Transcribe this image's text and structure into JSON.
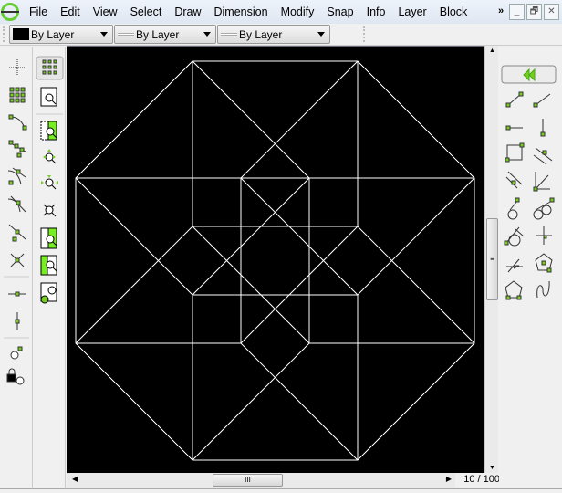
{
  "menu": [
    "File",
    "Edit",
    "View",
    "Select",
    "Draw",
    "Dimension",
    "Modify",
    "Snap",
    "Info",
    "Layer",
    "Block"
  ],
  "window_buttons": {
    "overflow": "»",
    "minimize": "_",
    "restore": "🗗",
    "close": "✕"
  },
  "pen_toolbar": {
    "color": "By Layer",
    "width": "By Layer",
    "linetype": "By Layer",
    "color_swatch": "#000000"
  },
  "snap_toolbar": [
    "snap-free",
    "snap-grid",
    "snap-endpoint",
    "snap-on-entity",
    "snap-center",
    "snap-middle",
    "snap-distance",
    "snap-intersection",
    "restrict-horizontal",
    "restrict-vertical",
    "set-relative-zero",
    "lock-relative-zero"
  ],
  "view_toolbar": [
    "grid-toggle",
    "zoom-redraw",
    "zoom-auto",
    "zoom-in",
    "zoom-out",
    "zoom-extents",
    "zoom-previous",
    "zoom-window",
    "zoom-pan"
  ],
  "line_toolbar": [
    "back",
    "line-2points",
    "line-angle",
    "line-horizontal",
    "line-vertical",
    "line-rectangle",
    "line-parallel-through",
    "line-parallel",
    "line-bisector",
    "line-tangent-point-circle",
    "line-tangent-two-circles",
    "line-tangent-orthogonal",
    "line-orthogonal",
    "line-relative-angle",
    "line-polygon-center",
    "line-polygon-corners",
    "freehand-line"
  ],
  "scroll": {
    "grip": "III"
  },
  "zoom_label": "10 / 100",
  "accent": "#66cc22"
}
